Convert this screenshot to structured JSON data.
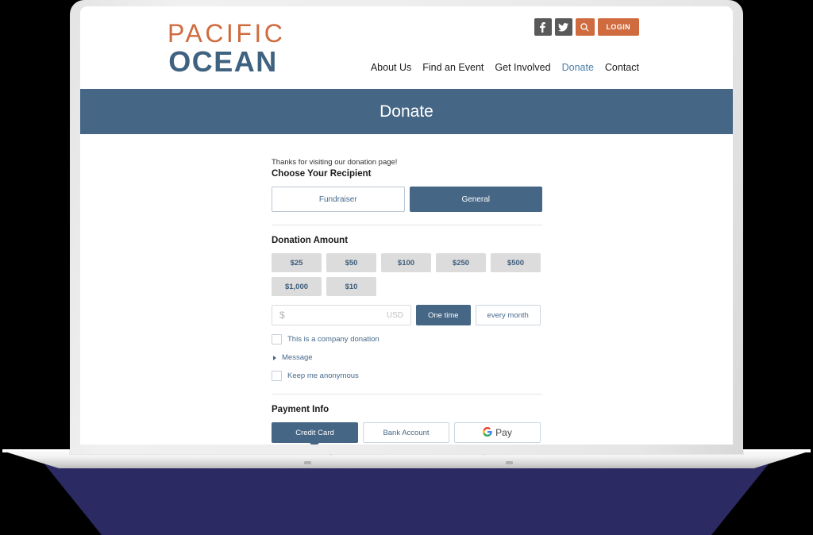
{
  "site": {
    "logo": {
      "line1": "PACIFIC",
      "line2": "OCEAN",
      "color_top": "#cf6b3f",
      "color_bottom": "#3f6280"
    },
    "utility": {
      "facebook_label": "f",
      "twitter_label": "t",
      "search_label": "search-icon",
      "login_label": "LOGIN",
      "social_bg": "#595959",
      "accent_bg": "#cf6b3f"
    },
    "nav": {
      "items": [
        {
          "label": "About Us",
          "active": false
        },
        {
          "label": "Find an Event",
          "active": false
        },
        {
          "label": "Get Involved",
          "active": false
        },
        {
          "label": "Donate",
          "active": true
        },
        {
          "label": "Contact",
          "active": false
        }
      ],
      "active_color": "#4a7fa8"
    },
    "banner": {
      "title": "Donate",
      "bg": "#466685",
      "text_color": "#ffffff"
    }
  },
  "donate": {
    "intro_text": "Thanks for visiting our donation page!",
    "recipient": {
      "heading": "Choose Your Recipient",
      "options": [
        {
          "label": "Fundraiser",
          "selected": false
        },
        {
          "label": "General",
          "selected": true
        }
      ]
    },
    "amount": {
      "heading": "Donation Amount",
      "presets": [
        "$25",
        "$50",
        "$100",
        "$250",
        "$500",
        "$1,000",
        "$10"
      ],
      "custom": {
        "placeholder_symbol": "$",
        "currency_code": "USD",
        "value": ""
      },
      "frequency": [
        {
          "label": "One time",
          "selected": true
        },
        {
          "label": "every month",
          "selected": false
        }
      ]
    },
    "options": [
      {
        "type": "checkbox",
        "label": "This is a company donation",
        "checked": false
      },
      {
        "type": "disclosure",
        "label": "Message",
        "expanded": false
      },
      {
        "type": "checkbox",
        "label": "Keep me anonymous",
        "checked": false
      }
    ],
    "payment": {
      "heading": "Payment Info",
      "methods": [
        {
          "label": "Credit Card",
          "selected": true
        },
        {
          "label": "Bank Account",
          "selected": false
        },
        {
          "label": "Pay",
          "selected": false,
          "icon": "google-g-icon"
        }
      ]
    }
  },
  "device": {
    "shadow_color": "#2c2a63",
    "bezel_color": "#ededed"
  }
}
